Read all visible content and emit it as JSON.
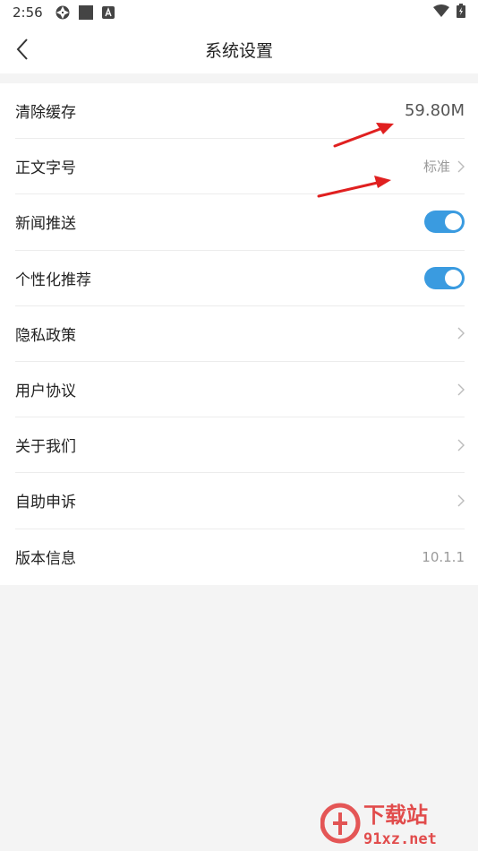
{
  "status_bar": {
    "time": "2:56"
  },
  "header": {
    "title": "系统设置"
  },
  "settings": {
    "cache": {
      "label": "清除缓存",
      "value": "59.80M"
    },
    "font_size": {
      "label": "正文字号",
      "value": "标准"
    },
    "news_push": {
      "label": "新闻推送",
      "enabled": true
    },
    "personalized": {
      "label": "个性化推荐",
      "enabled": true
    },
    "privacy": {
      "label": "隐私政策"
    },
    "agreement": {
      "label": "用户协议"
    },
    "about": {
      "label": "关于我们"
    },
    "appeal": {
      "label": "自助申诉"
    },
    "version": {
      "label": "版本信息",
      "value": "10.1.1"
    }
  },
  "watermark": {
    "brand": "下载站",
    "site": "91xz.net"
  },
  "colors": {
    "toggle_on": "#3a9be0",
    "annotation_arrow": "#e02020",
    "watermark": "#e03a3a"
  }
}
